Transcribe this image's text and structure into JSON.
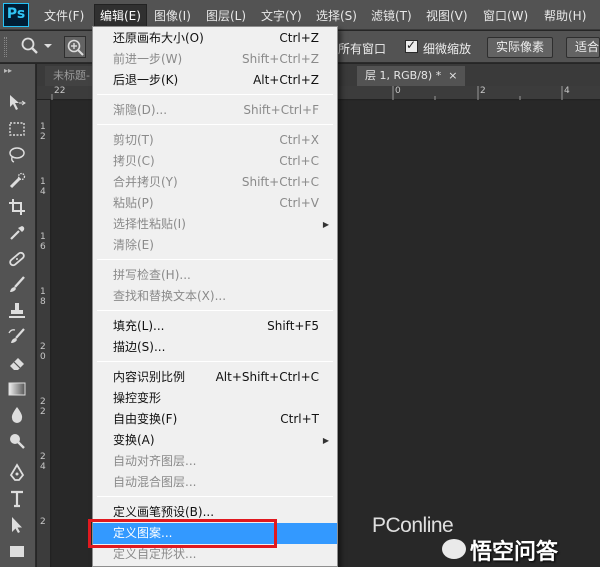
{
  "app": {
    "logo": "Ps"
  },
  "menubar": {
    "items": [
      {
        "label": "文件(F)"
      },
      {
        "label": "编辑(E)"
      },
      {
        "label": "图像(I)"
      },
      {
        "label": "图层(L)"
      },
      {
        "label": "文字(Y)"
      },
      {
        "label": "选择(S)"
      },
      {
        "label": "滤镜(T)"
      },
      {
        "label": "视图(V)"
      },
      {
        "label": "窗口(W)"
      },
      {
        "label": "帮助(H)"
      }
    ]
  },
  "options": {
    "all_windows": "所有窗口",
    "scrubby_zoom": "细微缩放",
    "actual_pixels": "实际像素",
    "fit_screen": "适合"
  },
  "tabs": {
    "inactive": "未标题-",
    "active": "层 1, RGB/8) *",
    "close": "×"
  },
  "ruler_h": [
    "22",
    "0",
    "2",
    "4"
  ],
  "ruler_v": [
    "1",
    "2",
    "1",
    "4",
    "1",
    "6",
    "1",
    "8",
    "2",
    "0",
    "2",
    "2",
    "2",
    "4",
    "2"
  ],
  "edit_menu": {
    "items": [
      {
        "label": "还原画布大小(O)",
        "shortcut": "Ctrl+Z"
      },
      {
        "label": "前进一步(W)",
        "shortcut": "Shift+Ctrl+Z"
      },
      {
        "label": "后退一步(K)",
        "shortcut": "Alt+Ctrl+Z"
      },
      {
        "label": "渐隐(D)...",
        "shortcut": "Shift+Ctrl+F"
      },
      {
        "label": "剪切(T)",
        "shortcut": "Ctrl+X"
      },
      {
        "label": "拷贝(C)",
        "shortcut": "Ctrl+C"
      },
      {
        "label": "合并拷贝(Y)",
        "shortcut": "Shift+Ctrl+C"
      },
      {
        "label": "粘贴(P)",
        "shortcut": "Ctrl+V"
      },
      {
        "label": "选择性粘贴(I)",
        "shortcut": ""
      },
      {
        "label": "清除(E)",
        "shortcut": ""
      },
      {
        "label": "拼写检查(H)...",
        "shortcut": ""
      },
      {
        "label": "查找和替换文本(X)...",
        "shortcut": ""
      },
      {
        "label": "填充(L)...",
        "shortcut": "Shift+F5"
      },
      {
        "label": "描边(S)...",
        "shortcut": ""
      },
      {
        "label": "内容识别比例",
        "shortcut": "Alt+Shift+Ctrl+C"
      },
      {
        "label": "操控变形",
        "shortcut": ""
      },
      {
        "label": "自由变换(F)",
        "shortcut": "Ctrl+T"
      },
      {
        "label": "变换(A)",
        "shortcut": ""
      },
      {
        "label": "自动对齐图层...",
        "shortcut": ""
      },
      {
        "label": "自动混合图层...",
        "shortcut": ""
      },
      {
        "label": "定义画笔预设(B)...",
        "shortcut": ""
      },
      {
        "label": "定义图案...",
        "shortcut": ""
      },
      {
        "label": "定义自定形状...",
        "shortcut": ""
      }
    ]
  },
  "watermark": {
    "brand": "PConline",
    "text": "悟空问答"
  }
}
